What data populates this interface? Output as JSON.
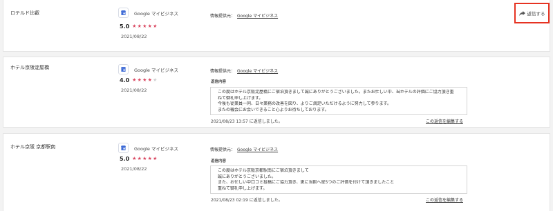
{
  "reviews": [
    {
      "name": "ロテルド比叡",
      "platform": "Google マイビジネス",
      "rating": "5.0",
      "rating_level": 5,
      "date": "2021/08/22",
      "info_source_label": "情報提供元：",
      "info_source_link": "Google マイビジネス",
      "reply_button_label": "返信する"
    },
    {
      "name": "ホテル京阪淀屋橋",
      "platform": "Google マイビジネス",
      "rating": "4.0",
      "rating_level": 4,
      "date": "2021/08/22",
      "info_source_label": "情報提供元：",
      "info_source_link": "Google マイビジネス",
      "reply_heading": "返信内容",
      "reply_lines": [
        "この度はホテル京阪淀屋橋にご宿泊頂きまして誠にありがとうございました。またお忙しい中、当ホテルの評価にご協力頂き重",
        "ねて御礼申し上げます。",
        "今後も従業員一同、日々業務の改善を図り、よりご満足いただけるように努力して参ります。",
        "またの機会にお会いできること心よりお待ちしております。"
      ],
      "reply_meta": "2021/08/23 13:57 に返信しました。",
      "edit_link": "この返信を編集する"
    },
    {
      "name": "ホテル京阪 京都駅南",
      "platform": "Google マイビジネス",
      "rating": "5.0",
      "rating_level": 5,
      "date": "2021/08/22",
      "info_source_label": "情報提供元：",
      "info_source_link": "Google マイビジネス",
      "reply_heading": "返信内容",
      "reply_lines": [
        "この度はホテル京阪京都駅南にご宿泊頂きまして",
        "誠にありがとうございました。",
        "また、お忙しい中口コミ投稿にご協力頂き、更に当館へ星5つのご評価を付けて頂きましたこと",
        "重ねて御礼申し上げます。"
      ],
      "reply_meta": "2021/08/23 02:19 に返信しました。",
      "edit_link": "この返信を編集する"
    }
  ],
  "colors": {
    "star_on": "#d9455f",
    "star_off": "#cfcfcf",
    "highlight": "#e63322",
    "gmb_blue": "#3d6ad6"
  }
}
